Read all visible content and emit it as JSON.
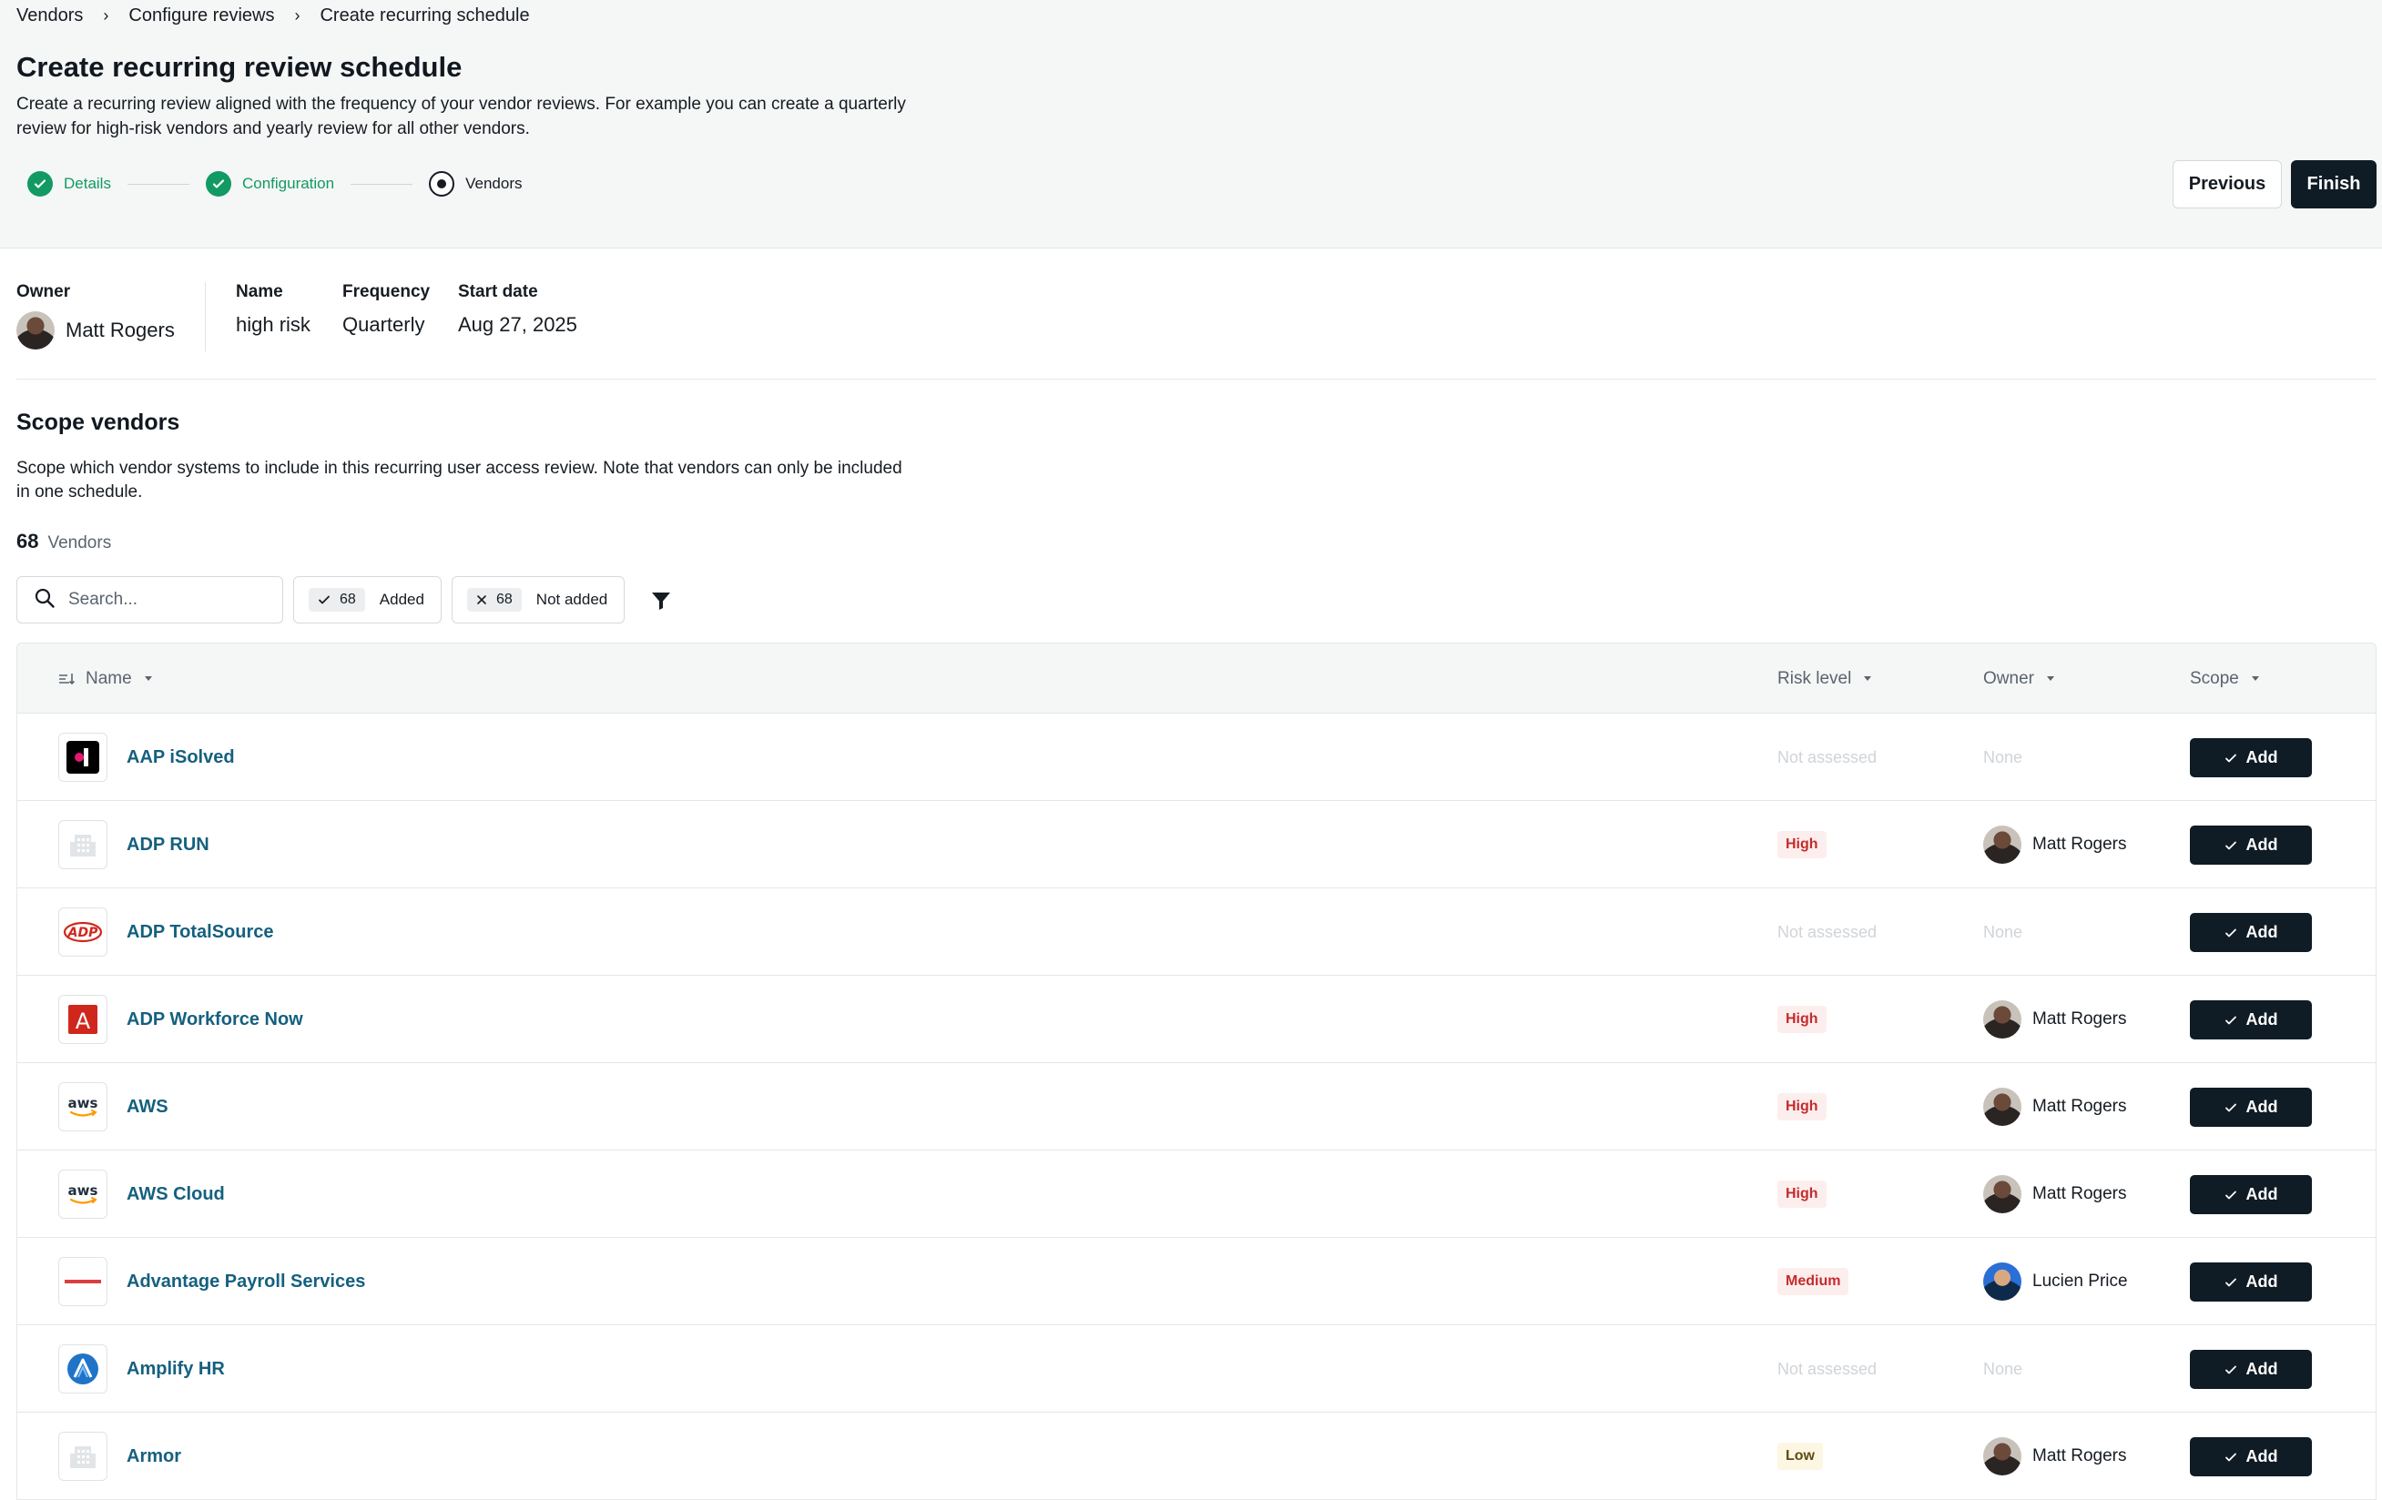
{
  "breadcrumb": [
    "Vendors",
    "Configure reviews",
    "Create recurring schedule"
  ],
  "page": {
    "title": "Create recurring review schedule",
    "description": "Create a recurring review aligned with the frequency of your vendor reviews. For example you can create a quarterly review for high-risk vendors and yearly review for all other vendors."
  },
  "stepper": [
    {
      "label": "Details",
      "state": "done"
    },
    {
      "label": "Configuration",
      "state": "done"
    },
    {
      "label": "Vendors",
      "state": "active"
    }
  ],
  "actions": {
    "previous": "Previous",
    "finish": "Finish"
  },
  "summary": {
    "owner_label": "Owner",
    "owner": "Matt Rogers",
    "name_label": "Name",
    "name": "high risk",
    "frequency_label": "Frequency",
    "frequency": "Quarterly",
    "start_label": "Start date",
    "start": "Aug 27, 2025"
  },
  "scope": {
    "title": "Scope vendors",
    "description": "Scope which vendor systems to include in this recurring user access review. Note that vendors can only be included in one schedule.",
    "count": "68",
    "count_label": "Vendors",
    "search_placeholder": "Search...",
    "added_count": "68",
    "added_label": "Added",
    "not_added_count": "68",
    "not_added_label": "Not added"
  },
  "table": {
    "headers": {
      "name": "Name",
      "risk": "Risk level",
      "owner": "Owner",
      "scope": "Scope"
    },
    "add_label": "Add",
    "rows": [
      {
        "name": "AAP iSolved",
        "risk": "Not assessed",
        "owner": "None",
        "logo": "isolved-logo"
      },
      {
        "name": "ADP RUN",
        "risk": "High",
        "owner": "Matt Rogers",
        "logo": "building-icon"
      },
      {
        "name": "ADP TotalSource",
        "risk": "Not assessed",
        "owner": "None",
        "logo": "adp-logo"
      },
      {
        "name": "ADP Workforce Now",
        "risk": "High",
        "owner": "Matt Rogers",
        "logo": "adp-a-logo"
      },
      {
        "name": "AWS",
        "risk": "High",
        "owner": "Matt Rogers",
        "logo": "aws-logo"
      },
      {
        "name": "AWS Cloud",
        "risk": "High",
        "owner": "Matt Rogers",
        "logo": "aws-logo"
      },
      {
        "name": "Advantage Payroll Services",
        "risk": "Medium",
        "owner": "Lucien Price",
        "logo": "advantage-logo"
      },
      {
        "name": "Amplify HR",
        "risk": "Not assessed",
        "owner": "None",
        "logo": "amplify-logo"
      },
      {
        "name": "Armor",
        "risk": "Low",
        "owner": "Matt Rogers",
        "logo": "building-icon"
      }
    ]
  },
  "colors": {
    "accent_dark": "#0f1b25",
    "success": "#129a63",
    "link": "#15607f",
    "high": "#c52b2b"
  }
}
